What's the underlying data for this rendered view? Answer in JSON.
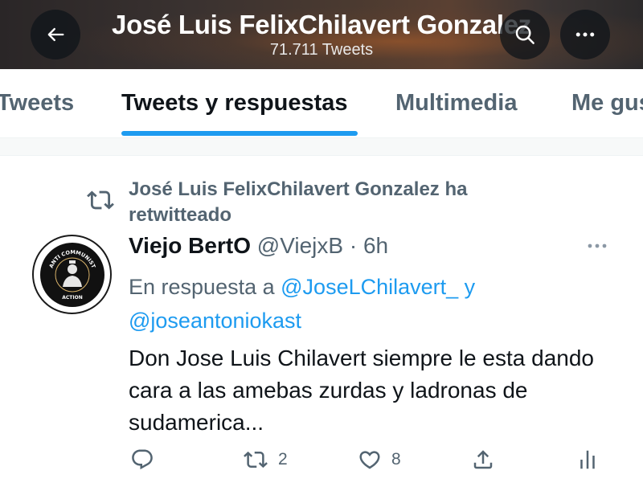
{
  "header": {
    "title": "José Luis FelixChilavert Gonzalez",
    "subtitle": "71.711 Tweets",
    "back_icon": "arrow-left-icon",
    "search_icon": "search-icon",
    "more_icon": "more-horizontal-icon"
  },
  "tabs": [
    {
      "label": "Tweets",
      "active": false
    },
    {
      "label": "Tweets y respuestas",
      "active": true
    },
    {
      "label": "Multimedia",
      "active": false
    },
    {
      "label": "Me gusta",
      "active": false
    }
  ],
  "retweet_context": {
    "icon": "retweet-icon",
    "text": "José Luis FelixChilavert Gonzalez ha retwitteado"
  },
  "tweet": {
    "avatar_text_top": "ANTI COMMUNIST",
    "avatar_text_bottom": "ACTION",
    "author_name": "Viejo BertO",
    "author_handle": "@ViejxB",
    "separator": "·",
    "time": "6h",
    "reply_prefix": "En respuesta a",
    "reply_to_1": "@JoseLChilavert_",
    "reply_joiner": "y",
    "reply_to_2": "@joseantoniokast",
    "text": "Don Jose Luis Chilavert siempre le esta dando cara a las amebas zurdas y ladronas de sudamerica...",
    "actions": {
      "reply_count": "",
      "retweet_count": "2",
      "like_count": "8"
    }
  },
  "colors": {
    "accent": "#1d9bf0",
    "secondary_text": "#536471",
    "primary_text": "#0f1419"
  }
}
